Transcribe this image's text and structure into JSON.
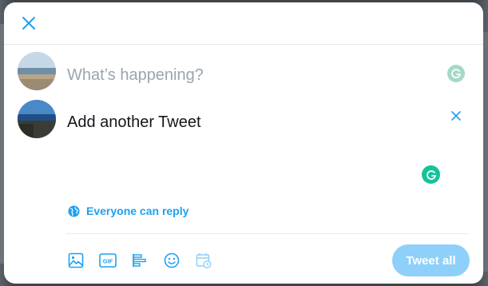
{
  "compose": {
    "placeholder": "What’s happening?",
    "second_tweet_text": "Add another Tweet"
  },
  "reply_setting": {
    "label": "Everyone can reply"
  },
  "toolbar": {
    "icons": [
      "image-icon",
      "gif-icon",
      "poll-icon",
      "emoji-icon",
      "schedule-icon"
    ],
    "gif_label": "GIF",
    "tweet_all_label": "Tweet all"
  },
  "colors": {
    "accent": "#1da1f2",
    "button_disabled": "#8ed0f9",
    "grammarly_active": "#15c39a",
    "grammarly_inactive": "#a5d9c6",
    "divider": "#e1e8ed"
  }
}
